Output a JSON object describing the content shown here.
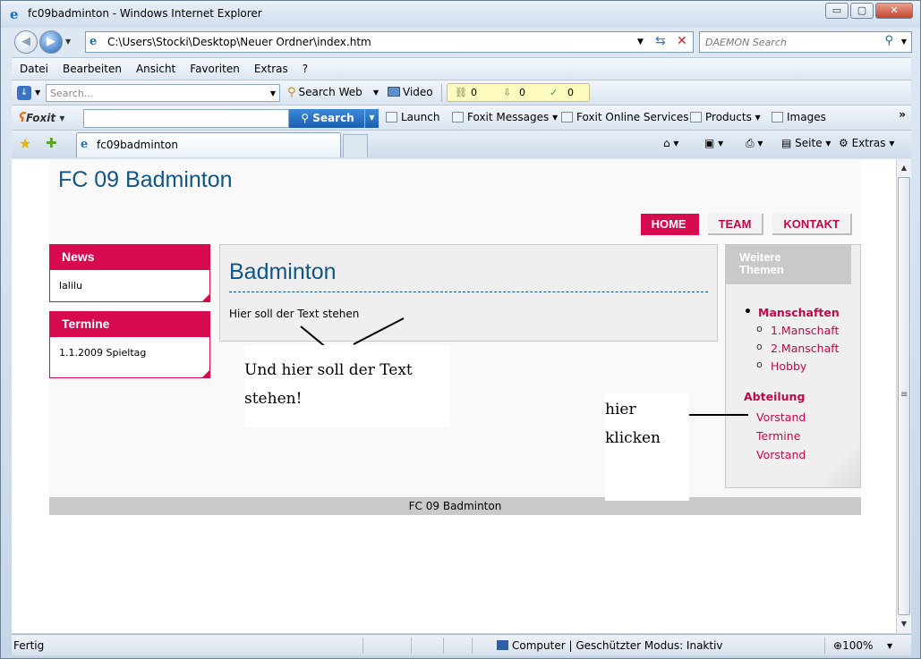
{
  "window": {
    "title": "fc09badminton - Windows Internet Explorer",
    "buttons": {
      "minimize": "▭",
      "maximize": "▢",
      "close": "✕"
    }
  },
  "address": {
    "url": "C:\\Users\\Stocki\\Desktop\\Neuer Ordner\\index.htm",
    "search_placeholder": "DAEMON Search"
  },
  "menu": [
    "Datei",
    "Bearbeiten",
    "Ansicht",
    "Favoriten",
    "Extras",
    "?"
  ],
  "toolbar1": {
    "search_placeholder": "Search...",
    "search_web": "Search Web",
    "video": "Video",
    "counters": [
      "0",
      "0",
      "0"
    ]
  },
  "toolbar2": {
    "foxit_label": "Foxit",
    "search_button": "Search",
    "items": [
      "Launch",
      "Foxit Messages",
      "Foxit Online Services",
      "Products",
      "Images"
    ]
  },
  "tabs": {
    "active_label": "fc09badminton",
    "commands": [
      "Seite",
      "Extras"
    ]
  },
  "page": {
    "site_title": "FC 09 Badminton",
    "nav": [
      "HOME",
      "TEAM",
      "KONTAKT"
    ],
    "news": {
      "title": "News",
      "body": "lalilu"
    },
    "termine": {
      "title": "Termine",
      "body": "1.1.2009 Spieltag"
    },
    "main": {
      "heading": "Badminton",
      "text": "Hier soll der Text stehen"
    },
    "sidebar": {
      "title_line1": "Weitere",
      "title_line2": "Themen",
      "list_head": "Manschaften",
      "sub_items": [
        "1.Manschaft",
        "2.Manschaft",
        "Hobby"
      ],
      "section2": "Abteilung",
      "links": [
        "Vorstand",
        "Termine",
        "Vorstand"
      ]
    },
    "footer": "FC 09 Badminton"
  },
  "annotations": {
    "note1": "Und hier soll der Text stehen!",
    "note2": "hier klicken"
  },
  "status": {
    "left": "Fertig",
    "zone": "Computer | Geschützter Modus: Inaktiv",
    "zoom": "100%"
  }
}
